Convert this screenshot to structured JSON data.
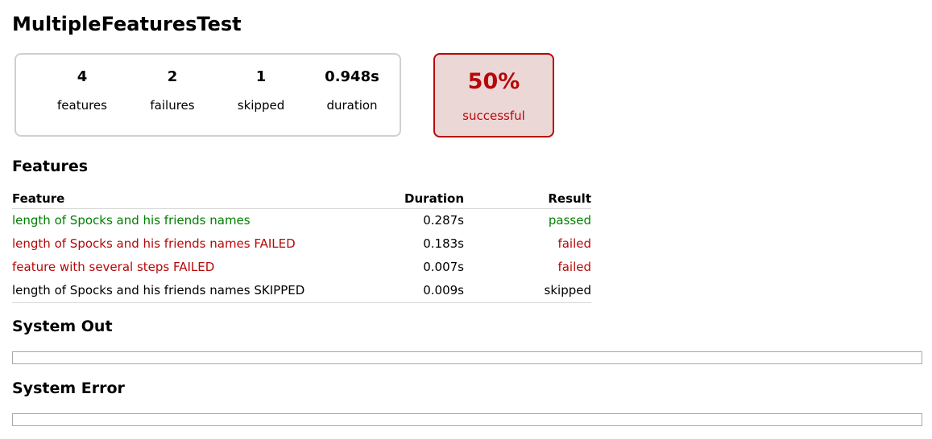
{
  "page": {
    "title": "MultipleFeaturesTest"
  },
  "summary": {
    "counters": [
      {
        "value": "4",
        "label": "features"
      },
      {
        "value": "2",
        "label": "failures"
      },
      {
        "value": "1",
        "label": "skipped"
      },
      {
        "value": "0.948s",
        "label": "duration"
      }
    ],
    "success": {
      "percent": "50%",
      "label": "successful"
    }
  },
  "features_section": {
    "heading": "Features",
    "columns": {
      "feature": "Feature",
      "duration": "Duration",
      "result": "Result"
    },
    "rows": [
      {
        "feature": "length of Spocks and his friends names",
        "duration": "0.287s",
        "result": "passed"
      },
      {
        "feature": "length of Spocks and his friends names FAILED",
        "duration": "0.183s",
        "result": "failed"
      },
      {
        "feature": "feature with several steps FAILED",
        "duration": "0.007s",
        "result": "failed"
      },
      {
        "feature": "length of Spocks and his friends names SKIPPED",
        "duration": "0.009s",
        "result": "skipped"
      }
    ]
  },
  "system_out": {
    "heading": "System Out",
    "content": ""
  },
  "system_error": {
    "heading": "System Error",
    "content": ""
  },
  "colors": {
    "passed": "#008000",
    "failed": "#b60808",
    "failed_background": "#ecd7d7",
    "box_border": "#d0d0d0"
  }
}
